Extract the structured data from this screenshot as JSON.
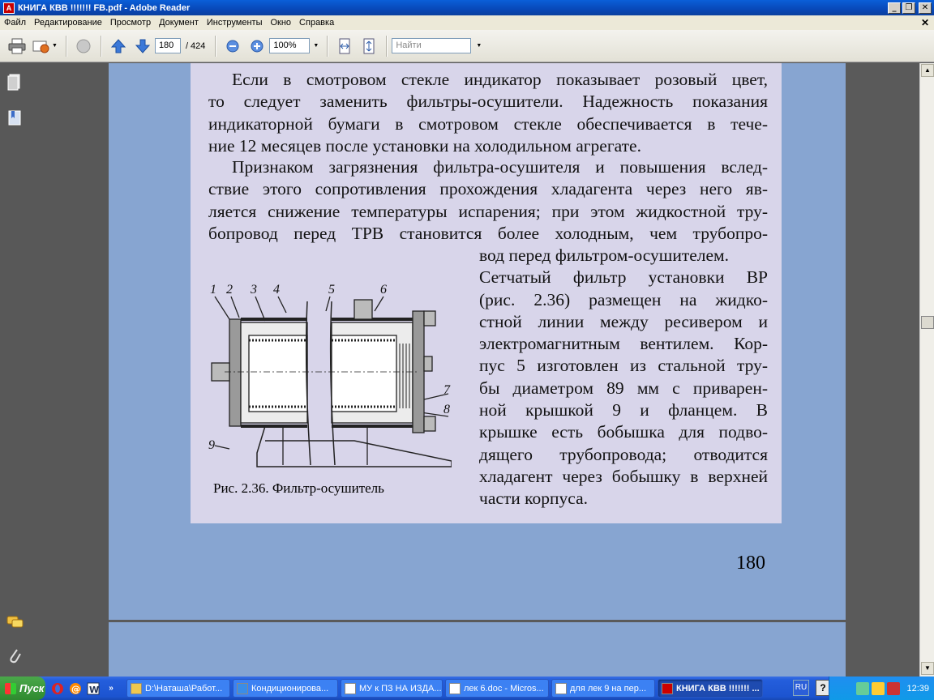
{
  "window": {
    "title": "КНИГА КВВ !!!!!!! FB.pdf - Adobe Reader"
  },
  "menu": [
    "Файл",
    "Редактирование",
    "Просмотр",
    "Документ",
    "Инструменты",
    "Окно",
    "Справка"
  ],
  "toolbar": {
    "page_current": "180",
    "page_total": "/ 424",
    "zoom": "100%",
    "search_placeholder": "Найти"
  },
  "document": {
    "paragraph1": [
      "Если в смотровом стекле индикатор показывает розовый цвет,",
      "то следует заменить фильтры-осушители. Надежность показания",
      "индикаторной бумаги в смотровом стекле обеспечивается в тече-",
      "ние 12 месяцев после установки на холодильном агрегате."
    ],
    "paragraph2": [
      "Признаком загрязнения фильтра-осушителя и повышения вслед-",
      "ствие этого сопротивления прохождения хладагента через него яв-",
      "ляется снижение температуры испарения; при этом жидкостной тру-",
      "бопровод перед ТРВ становится более холодным, чем трубопро-"
    ],
    "paragraph2_right": [
      "вод перед фильтром-осушителем.",
      "Сетчатый фильтр установки ВР",
      "(рис. 2.36) размещен на жидко-",
      "стной линии между ресивером и",
      "электромагнитным вентилем. Кор-",
      "пус 5 изготовлен из стальной тру-",
      "бы диаметром 89 мм с приварен-",
      "ной крышкой 9 и фланцем. В",
      "крышке есть бобышка для подво-",
      "дящего трубопровода; отводится",
      "хладагент через бобышку в верхней",
      "части корпуса."
    ],
    "figure_labels": [
      "1",
      "2",
      "3",
      "4",
      "5",
      "6",
      "7",
      "8",
      "9"
    ],
    "caption": "Рис. 2.36. Фильтр-осушитель",
    "page_number": "180"
  },
  "taskbar": {
    "start_label": "Пуск",
    "tasks": [
      "D:\\Наташа\\Работ...",
      "Кондиционирова...",
      "МУ к ПЗ НА ИЗДА...",
      "лек 6.doc - Micros...",
      "для лек 9 на пер...",
      "КНИГА КВВ !!!!!!! ..."
    ],
    "language": "RU",
    "clock": "12:39"
  }
}
